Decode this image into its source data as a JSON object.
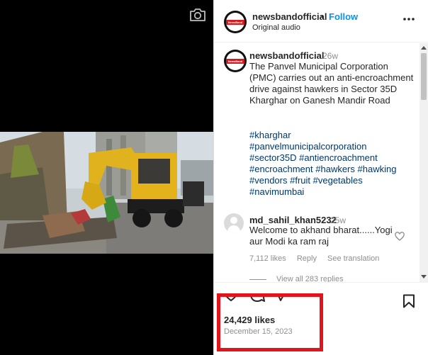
{
  "header": {
    "username": "newsbandofficial",
    "separator": "•",
    "follow_label": "Follow",
    "audio_label": "Original audio"
  },
  "caption": {
    "username": "newsbandofficial",
    "time": "26w",
    "text": "The Panvel Municipal Corporation (PMC) carries out an anti-encroachment drive against hawkers in Sector 35D Kharghar on Ganesh Mandir Road",
    "hashtags": [
      "#kharghar",
      "#panvelmunicipalcorporation",
      "#sector35D",
      "#antiencroachment",
      "#encroachment",
      "#hawkers",
      "#hawking",
      "#vendors",
      "#fruit",
      "#vegetables",
      "#navimumbai"
    ]
  },
  "comment": {
    "username": "md_sahil_khan5232",
    "time": "25w",
    "text": "Welcome to akhand bharat......Yogi aur Modi ka ram raj",
    "likes": "7,112 likes",
    "reply_label": "Reply",
    "translation_label": "See translation",
    "view_replies": "View all 283 replies"
  },
  "footer": {
    "likes": "24,429 likes",
    "date": "December 15, 2023"
  },
  "icons": {
    "camera": "camera-icon",
    "more": "more-options-icon",
    "heart": "heart-icon",
    "comment": "comment-icon",
    "share": "share-icon",
    "save": "bookmark-icon"
  },
  "colors": {
    "link_blue": "#0095f6",
    "hashtag_blue": "#00376b",
    "highlight_red": "#e3131c",
    "logo_red": "#d71920"
  },
  "avatar_logo_text": "NewsBand"
}
